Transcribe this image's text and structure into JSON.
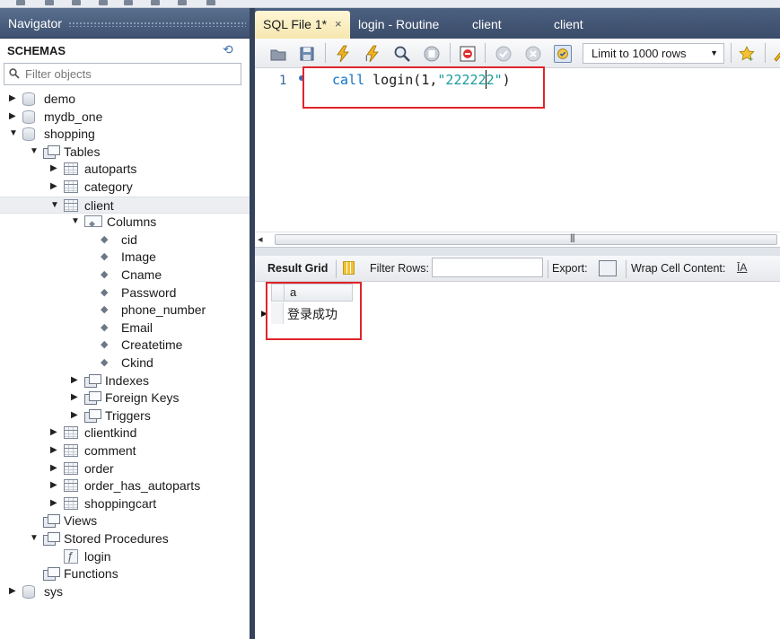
{
  "navigator": {
    "title": "Navigator",
    "schemas_label": "SCHEMAS",
    "filter_placeholder": "Filter objects",
    "tree": [
      {
        "label": "demo",
        "icon": "database-icon",
        "toggle": "collapsed"
      },
      {
        "label": "mydb_one",
        "icon": "database-icon",
        "toggle": "collapsed"
      },
      {
        "label": "shopping",
        "icon": "database-icon",
        "toggle": "expanded"
      },
      {
        "label": "Tables",
        "icon": "tables-group-icon",
        "toggle": "expanded"
      },
      {
        "label": "autoparts",
        "icon": "table-icon",
        "toggle": "collapsed"
      },
      {
        "label": "category",
        "icon": "table-icon",
        "toggle": "collapsed"
      },
      {
        "label": "client",
        "icon": "table-icon",
        "toggle": "expanded",
        "selected": true
      },
      {
        "label": "Columns",
        "icon": "columns-group-icon",
        "toggle": "expanded"
      },
      {
        "label": "cid",
        "icon": "column-icon"
      },
      {
        "label": "Image",
        "icon": "column-icon"
      },
      {
        "label": "Cname",
        "icon": "column-icon"
      },
      {
        "label": "Password",
        "icon": "column-icon"
      },
      {
        "label": "phone_number",
        "icon": "column-icon"
      },
      {
        "label": "Email",
        "icon": "column-icon"
      },
      {
        "label": "Createtime",
        "icon": "column-icon"
      },
      {
        "label": "Ckind",
        "icon": "column-icon"
      },
      {
        "label": "Indexes",
        "icon": "indexes-group-icon",
        "toggle": "collapsed"
      },
      {
        "label": "Foreign Keys",
        "icon": "foreign-keys-group-icon",
        "toggle": "collapsed"
      },
      {
        "label": "Triggers",
        "icon": "triggers-group-icon",
        "toggle": "collapsed"
      },
      {
        "label": "clientkind",
        "icon": "table-icon",
        "toggle": "collapsed"
      },
      {
        "label": "comment",
        "icon": "table-icon",
        "toggle": "collapsed"
      },
      {
        "label": "order",
        "icon": "table-icon",
        "toggle": "collapsed"
      },
      {
        "label": "order_has_autoparts",
        "icon": "table-icon",
        "toggle": "collapsed"
      },
      {
        "label": "shoppingcart",
        "icon": "table-icon",
        "toggle": "collapsed"
      },
      {
        "label": "Views",
        "icon": "views-group-icon"
      },
      {
        "label": "Stored Procedures",
        "icon": "procedures-group-icon",
        "toggle": "expanded"
      },
      {
        "label": "login",
        "icon": "procedure-icon"
      },
      {
        "label": "Functions",
        "icon": "functions-group-icon"
      },
      {
        "label": "sys",
        "icon": "database-icon",
        "toggle": "collapsed"
      }
    ]
  },
  "tabs": [
    {
      "label": "SQL File 1*",
      "active": true,
      "close": "×"
    },
    {
      "label": "login - Routine"
    },
    {
      "label": "client"
    },
    {
      "label": "client"
    }
  ],
  "toolbar": {
    "limit_label": "Limit to 1000 rows"
  },
  "editor": {
    "line_number": "1",
    "code_keyword": "call",
    "code_call": " login(1,",
    "code_string": "\"222222\"",
    "code_close": ")"
  },
  "result_toolbar": {
    "result_grid": "Result Grid",
    "filter_rows": "Filter Rows:",
    "export": "Export:",
    "wrap_cell": "Wrap Cell Content:"
  },
  "result_grid": {
    "columns": [
      "a"
    ],
    "rows": [
      [
        "登录成功"
      ]
    ]
  },
  "colors": {
    "navigator_header": "#4a5d7d",
    "active_tab": "#f8ebbd",
    "highlight_box": "#e0242a",
    "keyword": "#1273c7",
    "string": "#199c9c"
  }
}
